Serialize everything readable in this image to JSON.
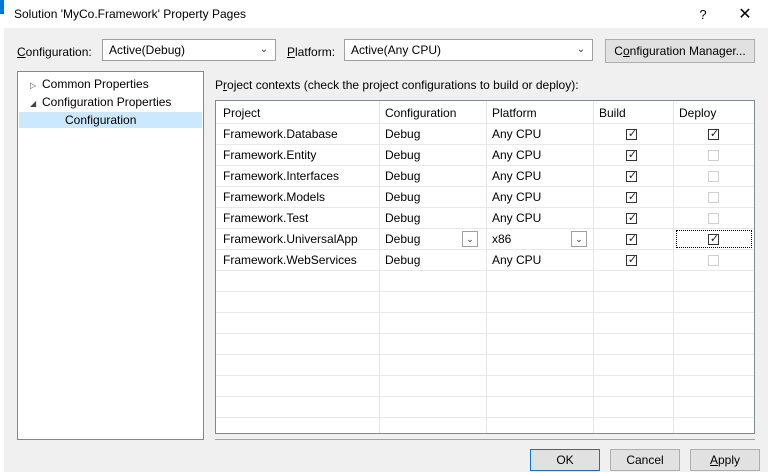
{
  "window": {
    "title": "Solution 'MyCo.Framework' Property Pages",
    "help_label": "?",
    "close_label": "✕"
  },
  "config_bar": {
    "configuration_label_u": "C",
    "configuration_label_rest": "onfiguration:",
    "configuration_value": "Active(Debug)",
    "platform_label_u": "P",
    "platform_label_rest": "latform:",
    "platform_value": "Active(Any CPU)",
    "manager_button_pre": "C",
    "manager_button_u": "o",
    "manager_button_rest": "nfiguration Manager..."
  },
  "tree": {
    "items": [
      {
        "label": "Common Properties",
        "expander": "▷"
      },
      {
        "label": "Configuration Properties",
        "expander": "◢"
      },
      {
        "label": "Configuration",
        "expander": ""
      }
    ]
  },
  "project_contexts": {
    "label_u": "r",
    "label_pre": "P",
    "label_rest": "oject contexts (check the project configurations to build or deploy):",
    "columns": [
      "Project",
      "Configuration",
      "Platform",
      "Build",
      "Deploy"
    ],
    "rows": [
      {
        "project": "Framework.Database",
        "configuration": "Debug",
        "platform": "Any CPU",
        "build": true,
        "deploy": true,
        "deploy_enabled": true
      },
      {
        "project": "Framework.Entity",
        "configuration": "Debug",
        "platform": "Any CPU",
        "build": true,
        "deploy": false,
        "deploy_enabled": false
      },
      {
        "project": "Framework.Interfaces",
        "configuration": "Debug",
        "platform": "Any CPU",
        "build": true,
        "deploy": false,
        "deploy_enabled": false
      },
      {
        "project": "Framework.Models",
        "configuration": "Debug",
        "platform": "Any CPU",
        "build": true,
        "deploy": false,
        "deploy_enabled": false
      },
      {
        "project": "Framework.Test",
        "configuration": "Debug",
        "platform": "Any CPU",
        "build": true,
        "deploy": false,
        "deploy_enabled": false
      },
      {
        "project": "Framework.UniversalApp",
        "configuration": "Debug",
        "platform": "x86",
        "build": true,
        "deploy": true,
        "deploy_enabled": true
      },
      {
        "project": "Framework.WebServices",
        "configuration": "Debug",
        "platform": "Any CPU",
        "build": true,
        "deploy": false,
        "deploy_enabled": false
      }
    ]
  },
  "footer": {
    "ok_label": "OK",
    "cancel_label": "Cancel",
    "apply_u": "A",
    "apply_rest": "pply"
  }
}
